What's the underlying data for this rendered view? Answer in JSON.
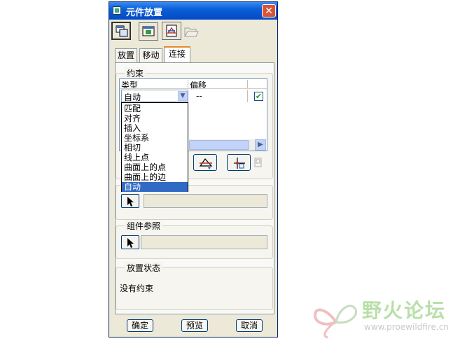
{
  "window": {
    "title": "元件放置",
    "close_label": "✕"
  },
  "toolbar": {
    "icons": [
      "placement-icon",
      "display-icon",
      "connect-icon",
      "open-folder-icon"
    ]
  },
  "tabs": [
    {
      "label": "放置"
    },
    {
      "label": "移动"
    },
    {
      "label": "连接"
    }
  ],
  "constraints": {
    "legend": "约束",
    "col_type": "类型",
    "col_offset": "偏移",
    "row": {
      "type": "自动",
      "offset": "--"
    },
    "dropdown_options": [
      "匹配",
      "对齐",
      "插入",
      "坐标系",
      "相切",
      "线上点",
      "曲面上的点",
      "曲面上的边",
      "自动"
    ],
    "selected_option": "自动"
  },
  "component_ref": {
    "legend": "组件参照"
  },
  "placement_status": {
    "legend": "放置状态",
    "text": "没有约束"
  },
  "buttons": {
    "ok": "确定",
    "preview": "预览",
    "cancel": "取消"
  },
  "watermark": {
    "title": "野火论坛",
    "url": "www.proewildfire.cn"
  }
}
